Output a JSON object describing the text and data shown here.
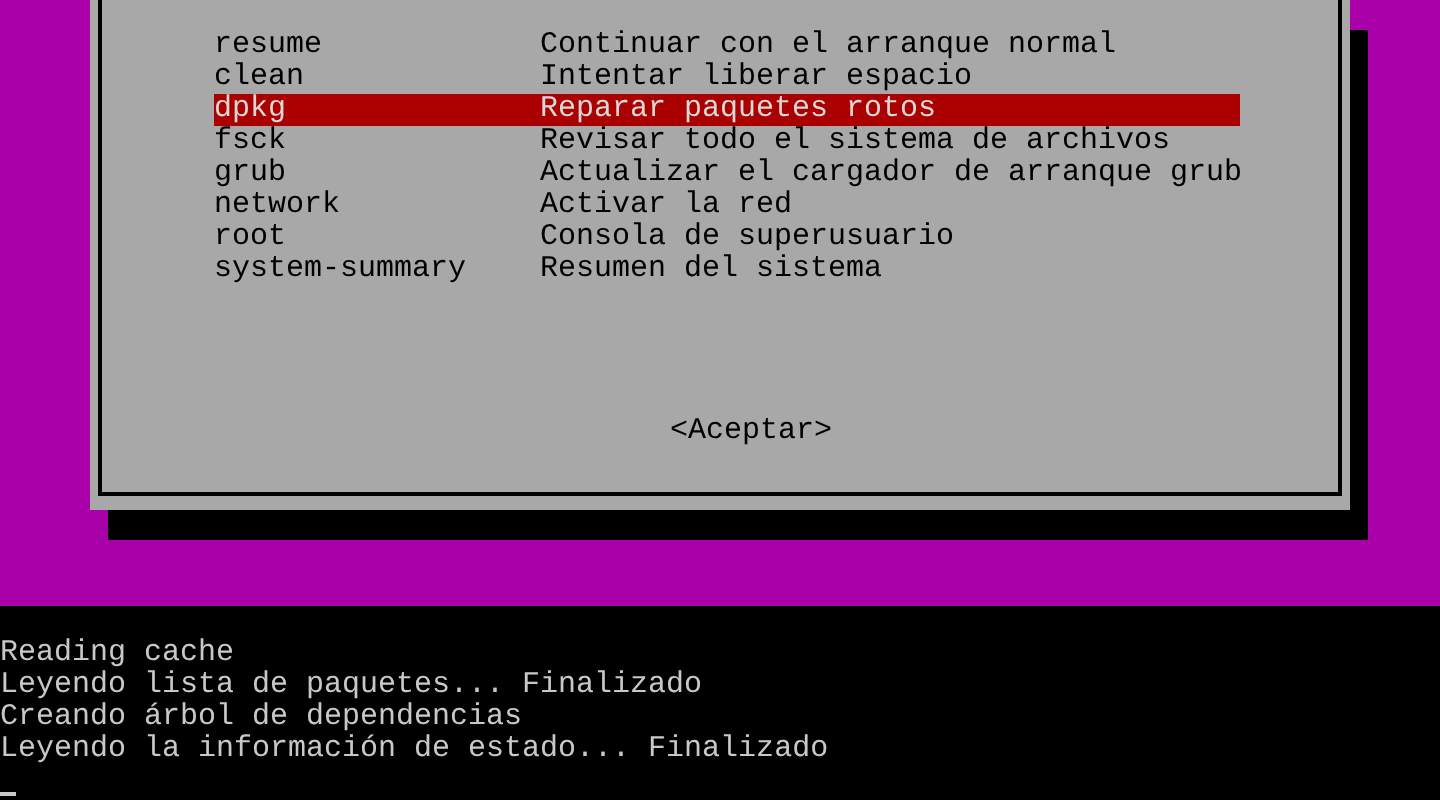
{
  "dialog": {
    "menu": [
      {
        "name": "resume",
        "description": "Continuar con el arranque normal",
        "selected": false
      },
      {
        "name": "clean",
        "description": "Intentar liberar espacio",
        "selected": false
      },
      {
        "name": "dpkg",
        "description": "Reparar paquetes rotos",
        "selected": true
      },
      {
        "name": "fsck",
        "description": "Revisar todo el sistema de archivos",
        "selected": false
      },
      {
        "name": "grub",
        "description": "Actualizar el cargador de arranque grub",
        "selected": false
      },
      {
        "name": "network",
        "description": "Activar la red",
        "selected": false
      },
      {
        "name": "root",
        "description": "Consola de superusuario",
        "selected": false
      },
      {
        "name": "system-summary",
        "description": "Resumen del sistema",
        "selected": false
      }
    ],
    "button": "<Aceptar>"
  },
  "console": {
    "lines": [
      "Reading cache",
      "Leyendo lista de paquetes... Finalizado",
      "Creando árbol de dependencias",
      "Leyendo la información de estado... Finalizado"
    ]
  }
}
